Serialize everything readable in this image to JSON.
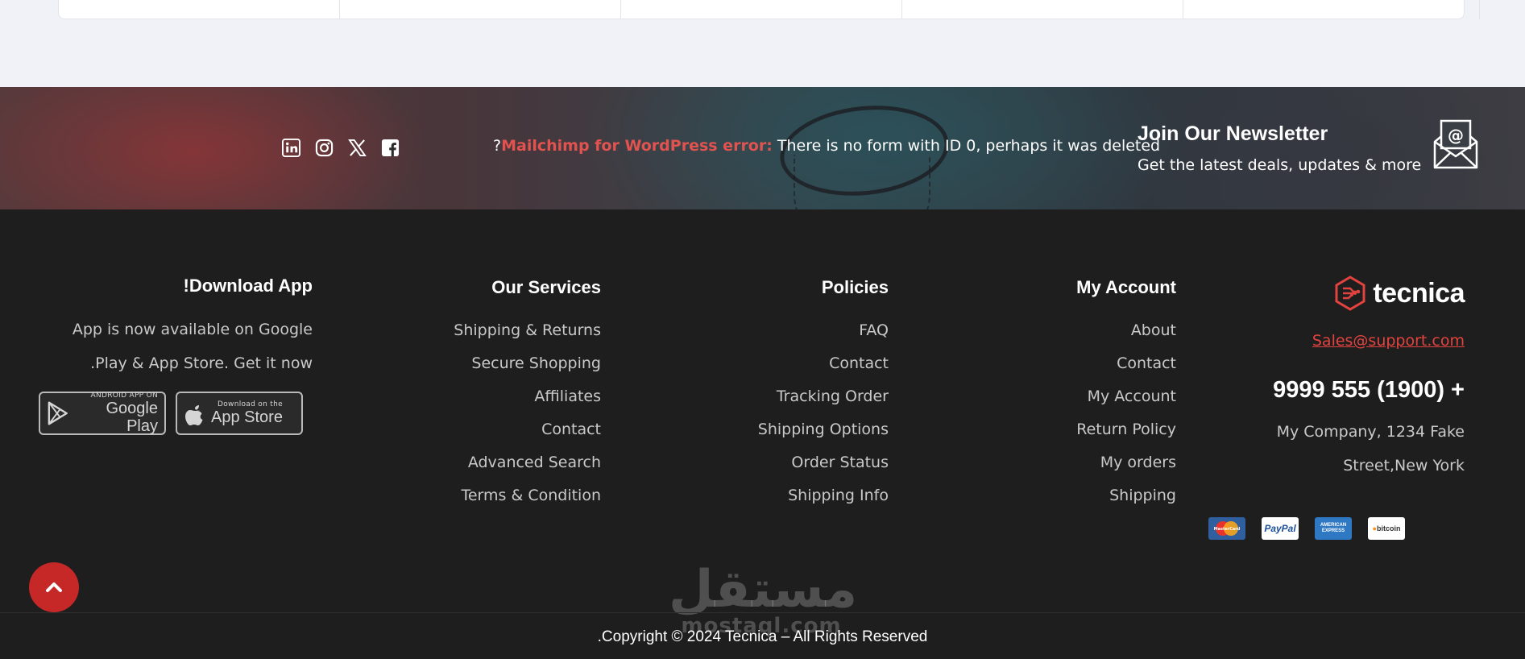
{
  "newsletter": {
    "error_prefix": "?",
    "error_label": "Mailchimp for WordPress error:",
    "error_message": "There is no form with ID 0, perhaps it was deleted",
    "title": "Join Our Newsletter",
    "subtitle": "Get the latest deals, updates & more",
    "social_icons": [
      "linkedin-icon",
      "instagram-icon",
      "x-icon",
      "facebook-icon"
    ]
  },
  "app": {
    "title": "!Download App",
    "line1": "App is now available on Google",
    "line2": ".Play & App Store. Get it now",
    "google_small": "ANDROID APP ON",
    "google_big": "Google Play",
    "apple_small": "Download on the",
    "apple_big": "App Store"
  },
  "services": {
    "title": "Our Services",
    "items": [
      "Shipping & Returns",
      "Secure Shopping",
      "Affiliates",
      "Contact",
      "Advanced Search",
      "Terms & Condition"
    ]
  },
  "policies": {
    "title": "Policies",
    "items": [
      "FAQ",
      "Contact",
      "Tracking Order",
      "Shipping Options",
      "Order Status",
      "Shipping Info"
    ]
  },
  "account": {
    "title": "My Account",
    "items": [
      "About",
      "Contact",
      "My Account",
      "Return Policy",
      "My orders",
      "Shipping"
    ]
  },
  "brand": {
    "name": "tecnica",
    "email": "Sales@support.com",
    "phone": "9999 555 (1900) +",
    "address_line1": "My Company, 1234 Fake",
    "address_line2": "Street,New York",
    "payments": [
      "MasterCard",
      "PayPal",
      "AMERICAN EXPRESS",
      "bitcoin"
    ],
    "accent": "#e2433f"
  },
  "watermark": {
    "arabic": "مستقل",
    "latin": "mostaql.com"
  },
  "copyright": ".Copyright © 2024 Tecnica – All Rights Reserved"
}
